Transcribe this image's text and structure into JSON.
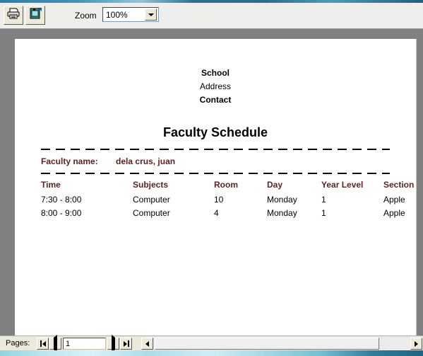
{
  "toolbar": {
    "print_icon": "printer-icon",
    "page_setup_icon": "page-setup-icon",
    "zoom_label": "Zoom",
    "zoom_value": "100%",
    "zoom_options": [
      "100%"
    ]
  },
  "document": {
    "header": {
      "school": "School",
      "address": "Address",
      "contact": "Contact"
    },
    "title": "Faculty Schedule",
    "faculty_name_label": "Faculty name:",
    "faculty_name_value": "dela crus, juan",
    "table": {
      "columns": [
        "Time",
        "Subjects",
        "Room",
        "Day",
        "Year Level",
        "Section"
      ],
      "rows": [
        {
          "time": "7:30 - 8:00",
          "subject": "Computer",
          "room": "10",
          "day": "Monday",
          "year_level": "1",
          "section": "Apple"
        },
        {
          "time": "8:00 - 9:00",
          "subject": "Computer",
          "room": "4",
          "day": "Monday",
          "year_level": "1",
          "section": "Apple"
        }
      ]
    }
  },
  "navigation": {
    "pages_label": "Pages:",
    "page_value": "1",
    "first_icon": "first-page-icon",
    "prev_icon": "previous-page-icon",
    "next_icon": "next-page-icon",
    "last_icon": "last-page-icon",
    "scroll_left_icon": "scroll-left-icon",
    "scroll_right_icon": "scroll-right-icon"
  },
  "colors": {
    "accent_maroon": "#5d1f1f",
    "canvas_gray": "#808080",
    "paper_white": "#ffffff",
    "chrome": "#ece9d8"
  }
}
